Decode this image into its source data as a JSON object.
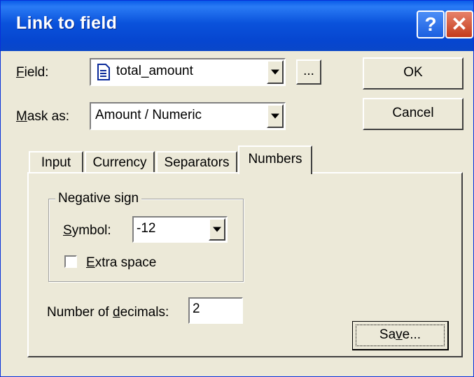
{
  "window": {
    "title": "Link to field",
    "help_label": "?",
    "close_label": "✕"
  },
  "field": {
    "label_key": "F",
    "label_rest": "ield:",
    "value": "total_amount",
    "icon": "document-icon",
    "browse_label": "..."
  },
  "mask": {
    "label_key": "M",
    "label_rest": "ask as:",
    "value": "Amount / Numeric"
  },
  "buttons": {
    "ok": "OK",
    "cancel": "Cancel",
    "save_pre": "Sa",
    "save_key": "v",
    "save_post": "e..."
  },
  "tabs": [
    {
      "label": "Input"
    },
    {
      "label": "Currency"
    },
    {
      "label": "Separators"
    },
    {
      "label": "Numbers",
      "selected": true
    }
  ],
  "negative_sign": {
    "group_title": "Negative sign",
    "symbol_label_key": "S",
    "symbol_label_rest": "ymbol:",
    "symbol_value": "-12",
    "extra_space_key": "E",
    "extra_space_rest": "xtra space",
    "extra_space_checked": false
  },
  "decimals": {
    "label_pre": "Number of ",
    "label_key": "d",
    "label_post": "ecimals:",
    "value": "2"
  }
}
